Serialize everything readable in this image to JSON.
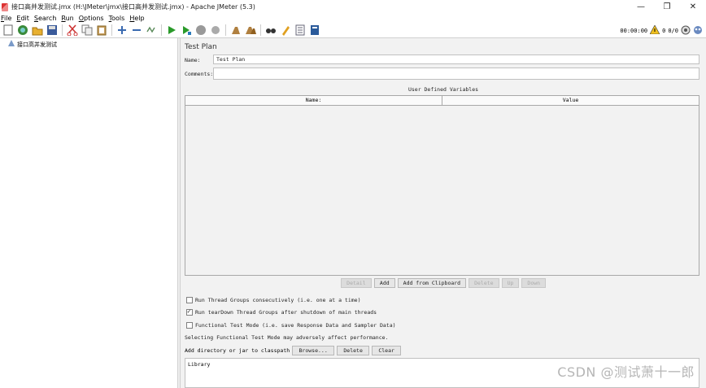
{
  "window": {
    "title": "接口高并发测试.jmx (H:\\JMeter\\jmx\\接口高并发测试.jmx) - Apache JMeter (5.3)",
    "minimize": "—",
    "maximize": "❐",
    "close": "✕"
  },
  "menu": [
    {
      "u": "F",
      "rest": "ile"
    },
    {
      "u": "E",
      "rest": "dit"
    },
    {
      "u": "S",
      "rest": "earch"
    },
    {
      "u": "R",
      "rest": "un"
    },
    {
      "u": "O",
      "rest": "ptions"
    },
    {
      "u": "T",
      "rest": "ools"
    },
    {
      "u": "H",
      "rest": "elp"
    }
  ],
  "toolbar_status": {
    "timer": "00:00:00",
    "errors": "0",
    "threads": "0/0"
  },
  "tree": {
    "root_label": "接口高并发测试"
  },
  "test_plan": {
    "title": "Test Plan",
    "name_label": "Name:",
    "name_value": "Test Plan",
    "comments_label": "Comments:",
    "comments_value": "",
    "udv_title": "User Defined Variables",
    "columns": [
      "Name:",
      "Value"
    ],
    "buttons": [
      {
        "label": "Detail",
        "enabled": false
      },
      {
        "label": "Add",
        "enabled": true
      },
      {
        "label": "Add from Clipboard",
        "enabled": true
      },
      {
        "label": "Delete",
        "enabled": false
      },
      {
        "label": "Up",
        "enabled": false
      },
      {
        "label": "Down",
        "enabled": false
      }
    ],
    "opt_serialize": "Run Thread Groups consecutively (i.e. one at a time)",
    "opt_serialize_checked": false,
    "opt_teardown": "Run tearDown Thread Groups after shutdown of main threads",
    "opt_teardown_checked": true,
    "opt_functional": "Functional Test Mode (i.e. save Response Data and Sampler Data)",
    "opt_functional_checked": false,
    "functional_note": "Selecting Functional Test Mode may adversely affect performance.",
    "classpath_label": "Add directory or jar to classpath",
    "browse": "Browse...",
    "delete": "Delete",
    "clear": "Clear",
    "library_header": "Library"
  },
  "watermark": "CSDN @测试萧十一郎"
}
